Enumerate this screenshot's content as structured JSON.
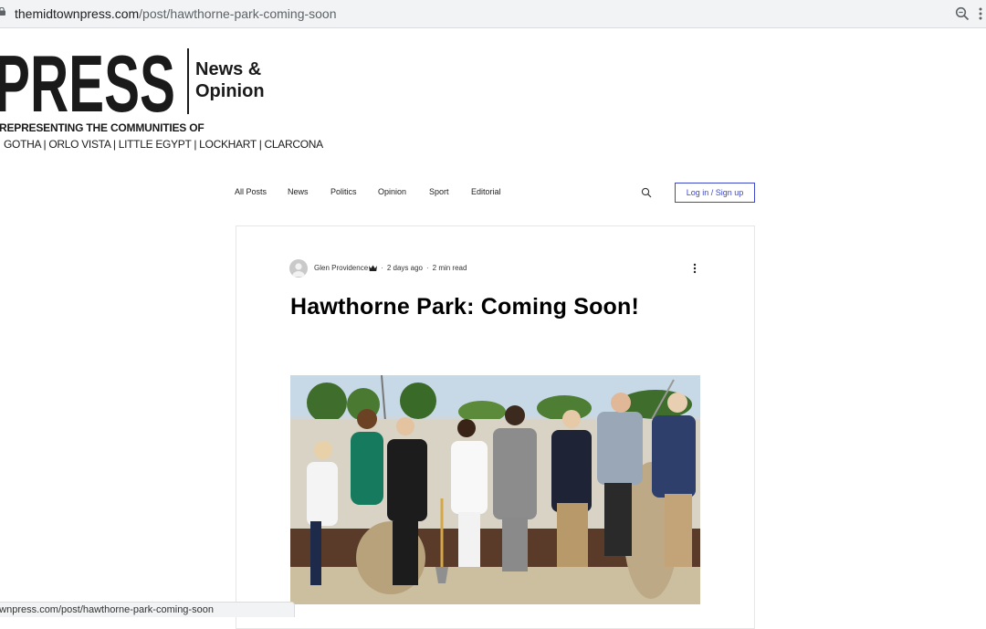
{
  "browser": {
    "url_domain": "themidtownpress.com",
    "url_path": "/post/hawthorne-park-coming-soon",
    "status_url": "townpress.com/post/hawthorne-park-coming-soon"
  },
  "masthead": {
    "logo_text": "PRESS",
    "side_line1": "News &",
    "side_line2": "Opinion",
    "tagline": "REPRESENTING THE COMMUNITIES OF",
    "communities": "GOTHA | ORLO VISTA | LITTLE EGYPT | LOCKHART | CLARCONA"
  },
  "nav": {
    "items": [
      "All Posts",
      "News",
      "Politics",
      "Opinion",
      "Sport",
      "Editorial"
    ],
    "login_label": "Log in / Sign up"
  },
  "post": {
    "author": "Glen Providence",
    "posted": "2 days ago",
    "read_time": "2 min read",
    "title": "Hawthorne Park: Coming Soon!"
  },
  "colors": {
    "accent": "#3d47c9",
    "text": "#1a1a1a"
  },
  "icons": [
    "lock-icon",
    "zoom-icon",
    "more-vert-icon",
    "search-icon",
    "crown-icon",
    "post-more-icon",
    "avatar-icon"
  ]
}
